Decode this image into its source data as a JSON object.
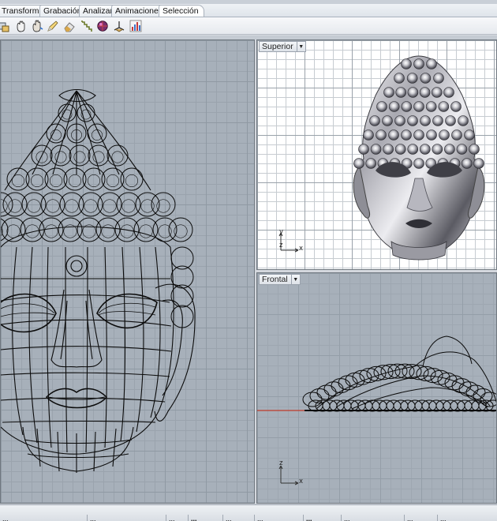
{
  "menu_tabs": [
    "Transformar",
    "Grabación",
    "Analizar",
    "Animaciones",
    "Selección"
  ],
  "toolbar": {
    "tools": [
      "transform-icon",
      "grab-icon",
      "hand-icon",
      "pencil-icon",
      "eraser-icon",
      "stairs-icon",
      "render-icon",
      "gumball-icon",
      "chart-icon"
    ]
  },
  "viewports": {
    "top": {
      "label": "Superior",
      "axis_x": "x",
      "axis_y": "y",
      "axis_z": "z"
    },
    "front": {
      "label": "Frontal",
      "axis_x": "x",
      "axis_z": "z"
    }
  },
  "statusbar": {
    "cells": [
      "...",
      "...",
      "...",
      "...",
      "...",
      "...",
      "...",
      "...",
      "...",
      "...",
      "..."
    ]
  },
  "colors": {
    "viewport_gray": "#a7b0ba",
    "top_view_bg": "#ffffff",
    "front_x_axis": "#c0392b"
  }
}
